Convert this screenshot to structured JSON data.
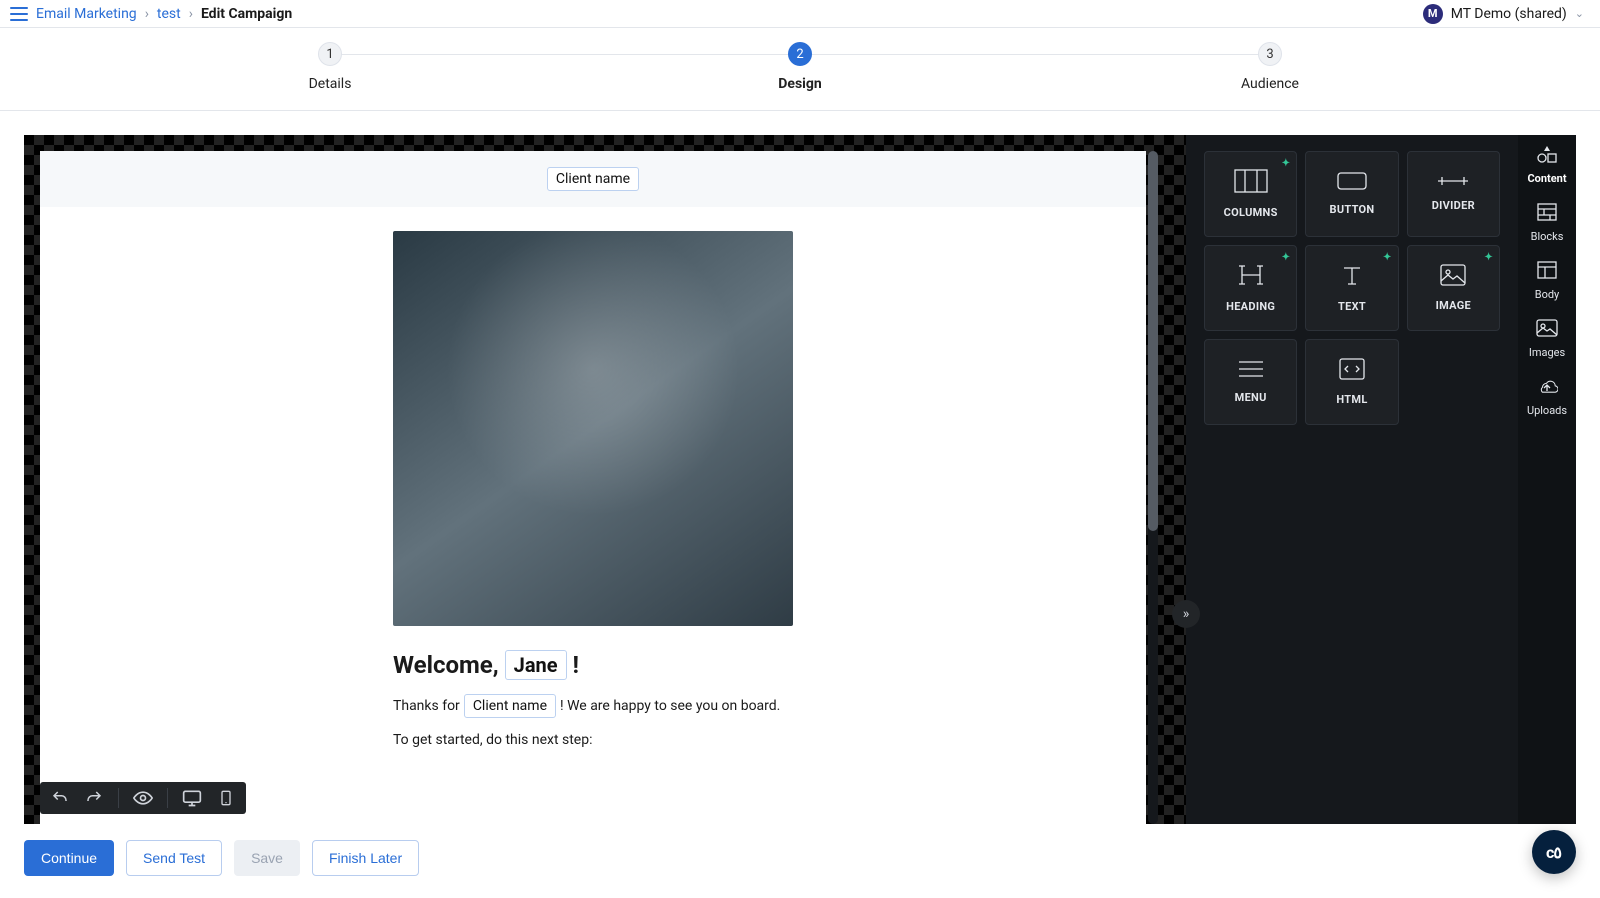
{
  "breadcrumbs": {
    "root": "Email Marketing",
    "campaign": "test",
    "current": "Edit Campaign"
  },
  "account": {
    "initial": "M",
    "name": "MT Demo (shared)"
  },
  "steps": [
    {
      "num": "1",
      "label": "Details"
    },
    {
      "num": "2",
      "label": "Design"
    },
    {
      "num": "3",
      "label": "Audience"
    }
  ],
  "active_step": 1,
  "email": {
    "header_tag": "Client name",
    "welcome_prefix": "Welcome,",
    "welcome_name_tag": "Jane",
    "welcome_suffix": "!",
    "line1_a": "Thanks for",
    "line1_tag": "Client name",
    "line1_b": "! We are happy to see you on board.",
    "line2": "To get started, do this next step:"
  },
  "blocks": [
    {
      "key": "columns",
      "label": "COLUMNS",
      "spark": true
    },
    {
      "key": "button",
      "label": "BUTTON",
      "spark": false
    },
    {
      "key": "divider",
      "label": "DIVIDER",
      "spark": false
    },
    {
      "key": "heading",
      "label": "HEADING",
      "spark": true
    },
    {
      "key": "text",
      "label": "TEXT",
      "spark": true
    },
    {
      "key": "image",
      "label": "IMAGE",
      "spark": true
    },
    {
      "key": "menu",
      "label": "MENU",
      "spark": false
    },
    {
      "key": "html",
      "label": "HTML",
      "spark": false
    }
  ],
  "tabs": [
    {
      "key": "content",
      "label": "Content"
    },
    {
      "key": "blocks",
      "label": "Blocks"
    },
    {
      "key": "body",
      "label": "Body"
    },
    {
      "key": "images",
      "label": "Images"
    },
    {
      "key": "uploads",
      "label": "Uploads"
    }
  ],
  "active_tab": 0,
  "actions": {
    "continue": "Continue",
    "send_test": "Send Test",
    "save": "Save",
    "finish_later": "Finish Later"
  },
  "fab": "c٥"
}
